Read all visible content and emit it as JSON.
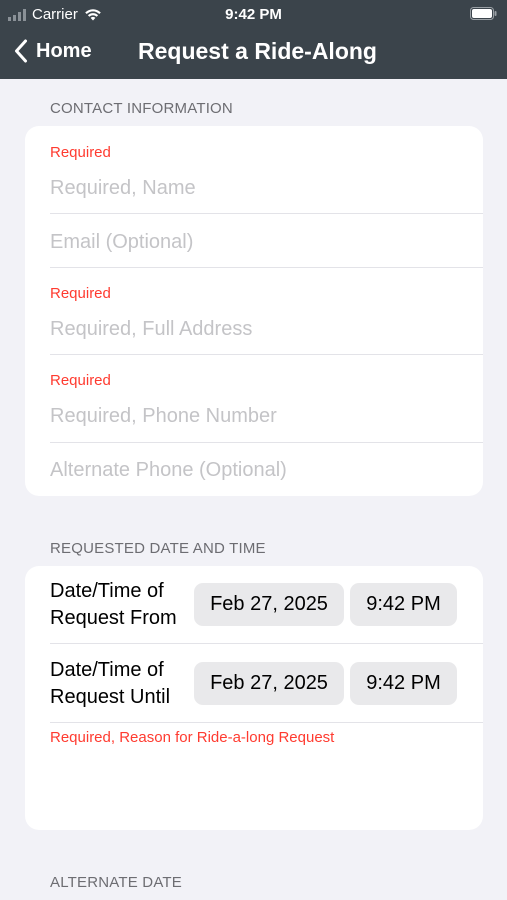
{
  "status_bar": {
    "carrier": "Carrier",
    "time": "9:42 PM"
  },
  "nav": {
    "back_label": "Home",
    "title": "Request a Ride-Along"
  },
  "contact": {
    "header": "CONTACT INFORMATION",
    "required_label": "Required",
    "name_placeholder": "Required, Name",
    "email_placeholder": "Email (Optional)",
    "address_placeholder": "Required, Full Address",
    "phone_placeholder": "Required, Phone Number",
    "alt_phone_placeholder": "Alternate Phone (Optional)"
  },
  "requested": {
    "header": "REQUESTED DATE AND TIME",
    "from_label_line1": "Date/Time of",
    "from_label_line2": "Request From",
    "from_date": "Feb 27, 2025",
    "from_time": "9:42 PM",
    "until_label_line1": "Date/Time of",
    "until_label_line2": "Request Until",
    "until_date": "Feb 27, 2025",
    "until_time": "9:42 PM",
    "reason_label": "Required, Reason for Ride-a-long Request"
  },
  "alternate": {
    "header": "ALTERNATE DATE"
  },
  "colors": {
    "nav_background": "#3b444b",
    "required_red": "#ff3b30",
    "page_background": "#f2f2f7"
  }
}
